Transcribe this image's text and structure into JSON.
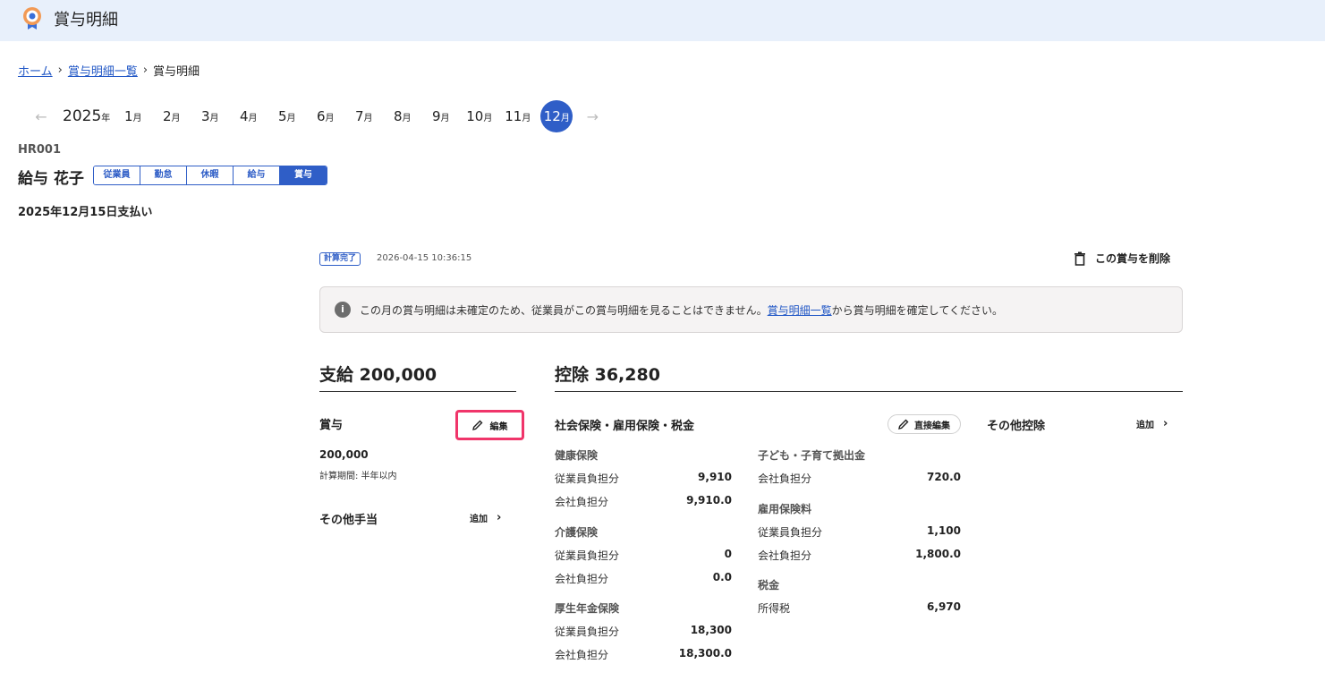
{
  "app": {
    "title": "賞与明細"
  },
  "breadcrumb": [
    {
      "label": "ホーム"
    },
    {
      "label": "賞与明細一覧"
    },
    {
      "label": "賞与明細"
    }
  ],
  "month_nav": {
    "year": "2025",
    "year_suffix": "年",
    "month_suffix": "月",
    "months": [
      "1",
      "2",
      "3",
      "4",
      "5",
      "6",
      "7",
      "8",
      "9",
      "10",
      "11",
      "12"
    ],
    "selected": "12"
  },
  "employee": {
    "code": "HR001",
    "name": "給与 花子",
    "tabs": [
      "従業員",
      "勤怠",
      "休暇",
      "給与",
      "賞与"
    ],
    "active_tab": "賞与"
  },
  "pay_date": "2025年12月15日支払い",
  "status": {
    "badge": "計算完了",
    "timestamp": "2026-04-15 10:36:15"
  },
  "delete_label": "この賞与を削除",
  "notice": {
    "before": "この月の賞与明細は未確定のため、従業員がこの賞与明細を見ることはできません。",
    "link": "賞与明細一覧",
    "after": "から賞与明細を確定してください。"
  },
  "payment": {
    "heading": "支給 200,000",
    "bonus_label": "賞与",
    "edit_label": "編集",
    "bonus_amount": "200,000",
    "period_note": "計算期間: 半年以内",
    "other_allowance_label": "その他手当",
    "add_label": "追加"
  },
  "deduction": {
    "heading": "控除 36,280",
    "social_label": "社会保険・雇用保険・税金",
    "direct_edit_label": "直接編集",
    "other_deduction_label": "その他控除",
    "add_label": "追加",
    "health": {
      "title": "健康保険",
      "employee_label": "従業員負担分",
      "employee": "9,910",
      "company_label": "会社負担分",
      "company": "9,910.0"
    },
    "care": {
      "title": "介護保険",
      "employee_label": "従業員負担分",
      "employee": "0",
      "company_label": "会社負担分",
      "company": "0.0"
    },
    "pension": {
      "title": "厚生年金保険",
      "employee_label": "従業員負担分",
      "employee": "18,300",
      "company_label": "会社負担分",
      "company": "18,300.0"
    },
    "child": {
      "title": "子ども・子育て拠出金",
      "company_label": "会社負担分",
      "company": "720.0"
    },
    "employment": {
      "title": "雇用保険料",
      "employee_label": "従業員負担分",
      "employee": "1,100",
      "company_label": "会社負担分",
      "company": "1,800.0"
    },
    "tax": {
      "title": "税金",
      "income_label": "所得税",
      "income": "6,970"
    }
  },
  "colors": {
    "accent": "#2f5ec7",
    "highlight": "#f0356a",
    "topbar": "#e8f0fb"
  }
}
